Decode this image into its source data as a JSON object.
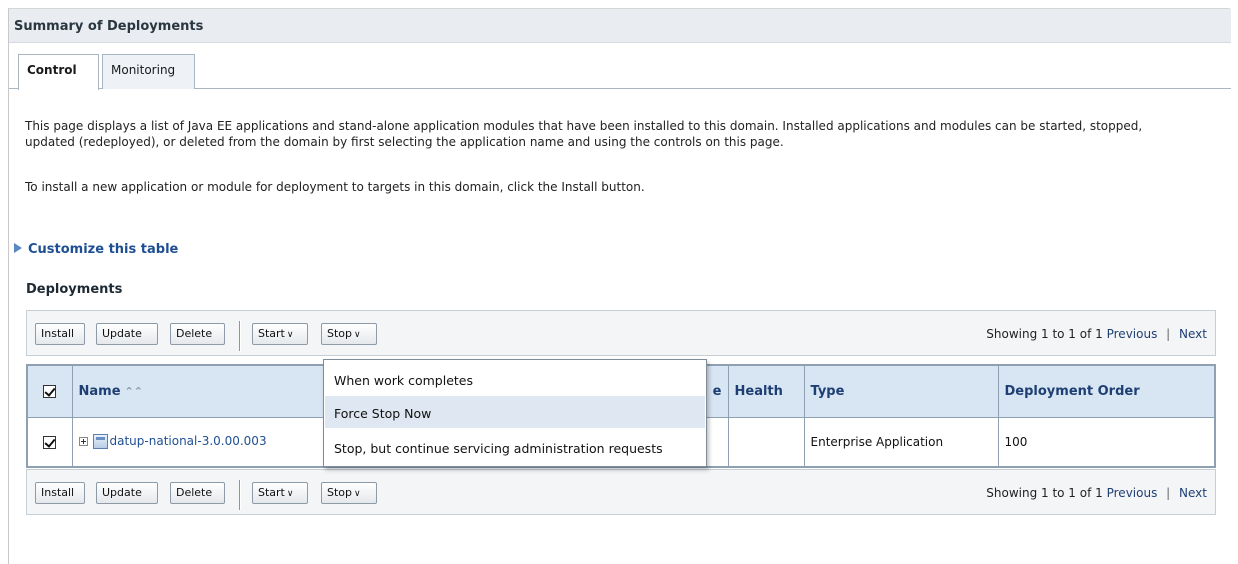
{
  "header": {
    "title": "Summary of Deployments"
  },
  "tabs": [
    {
      "label": "Control",
      "active": true
    },
    {
      "label": "Monitoring",
      "active": false
    }
  ],
  "description": {
    "paragraph1": "This page displays a list of Java EE applications and stand-alone application modules that have been installed to this domain. Installed applications and modules can be started, stopped, updated (redeployed), or deleted from the domain by first selecting the application name and using the controls on this page.",
    "paragraph2": "To install a new application or module for deployment to targets in this domain, click the Install button."
  },
  "customize_link": "Customize this table",
  "section_title": "Deployments",
  "toolbar": {
    "install": "Install",
    "update": "Update",
    "delete": "Delete",
    "start": "Start",
    "stop": "Stop",
    "pager_text": "Showing 1 to 1 of 1",
    "previous": "Previous",
    "separator": "|",
    "next": "Next"
  },
  "table": {
    "columns": [
      "Name",
      "State",
      "Health",
      "Type",
      "Deployment Order"
    ],
    "state_visible_fragment": "e",
    "rows": [
      {
        "checked": true,
        "name": "datup-national-3.0.00.003",
        "state": "",
        "health": "",
        "type": "Enterprise Application",
        "deployment_order": "100"
      }
    ]
  },
  "stop_menu": {
    "items": [
      "When work completes",
      "Force Stop Now",
      "Stop, but continue servicing administration requests"
    ],
    "highlighted_index": 1
  },
  "colors": {
    "header_bg": "#e9edf1",
    "table_header_bg": "#d8e5f2",
    "link": "#1f4f93",
    "menu_hover": "#dfe8f2"
  },
  "icons": {
    "sort": "double-chevron-up-icon",
    "expand": "plus-box-icon",
    "app": "enterprise-app-icon",
    "customize": "triangle-right-icon"
  }
}
